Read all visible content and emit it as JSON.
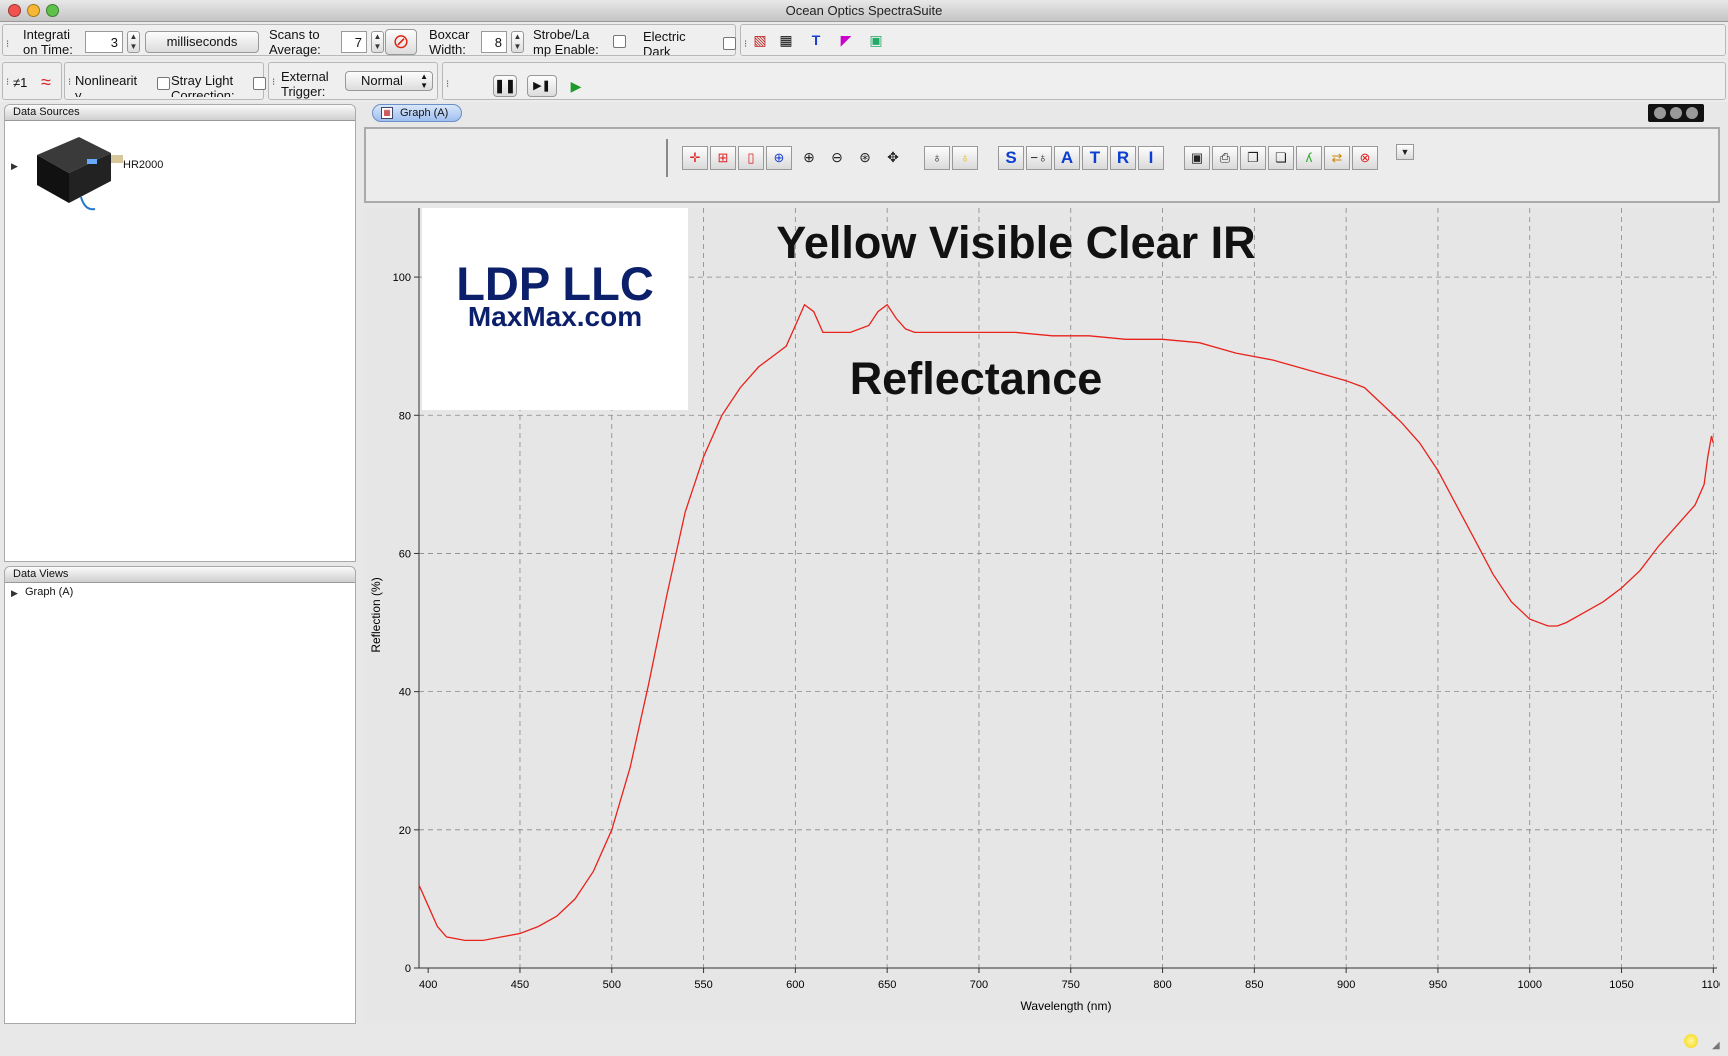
{
  "window": {
    "title": "Ocean Optics SpectraSuite"
  },
  "acquisition": {
    "integration_label": "Integrati\non Time:",
    "integration_value": "3",
    "units": "milliseconds",
    "scans_label": "Scans to\nAverage:",
    "scans_value": "7",
    "boxcar_label": "Boxcar\nWidth:",
    "boxcar_value": "8",
    "strobe_label": "Strobe/La\nmp Enable:",
    "dark_label": "Electric\nDark"
  },
  "corrections": {
    "channel": "≠1",
    "nonlinearity_label": "Nonlinearit\ny",
    "stray_label": "Stray Light\nCorrection:",
    "trigger_label": "External\nTrigger:",
    "trigger_value": "Normal"
  },
  "data_sources": {
    "header": "Data Sources",
    "device": "HR2000"
  },
  "data_views": {
    "header": "Data Views",
    "items": [
      "Graph (A)"
    ]
  },
  "graph": {
    "tab_label": "Graph (A)"
  },
  "chart_toolbar": {
    "letters": [
      "S",
      "A",
      "T",
      "R",
      "I"
    ]
  },
  "overlay": {
    "logo_line1": "LDP LLC",
    "logo_line2": "MaxMax.com",
    "heading": "Yellow Visible Clear IR",
    "subheading": "Reflectance"
  },
  "colors": {
    "curve": "#e8231c",
    "logo_text": "#0b1f6b"
  },
  "chart_data": {
    "type": "line",
    "xlabel": "Wavelength (nm)",
    "ylabel": "Reflection (%)",
    "xlim": [
      395,
      1102
    ],
    "ylim": [
      0,
      110
    ],
    "xticks": [
      400,
      450,
      500,
      550,
      600,
      650,
      700,
      750,
      800,
      850,
      900,
      950,
      1000,
      1050,
      1100
    ],
    "yticks": [
      0,
      20,
      40,
      60,
      80,
      100
    ],
    "grid": true,
    "x": [
      395,
      400,
      405,
      410,
      420,
      430,
      440,
      450,
      460,
      470,
      480,
      490,
      500,
      510,
      520,
      530,
      540,
      550,
      560,
      570,
      580,
      590,
      595,
      600,
      605,
      610,
      615,
      620,
      630,
      640,
      645,
      650,
      655,
      660,
      665,
      670,
      680,
      700,
      720,
      740,
      760,
      780,
      800,
      820,
      840,
      860,
      880,
      900,
      910,
      920,
      930,
      940,
      950,
      960,
      970,
      980,
      990,
      1000,
      1010,
      1015,
      1020,
      1030,
      1040,
      1050,
      1060,
      1070,
      1080,
      1090,
      1095,
      1097,
      1099,
      1100
    ],
    "y": [
      12,
      9,
      6,
      4.5,
      4,
      4,
      4.5,
      5,
      6,
      7.5,
      10,
      14,
      20,
      29,
      41,
      54,
      66,
      74,
      80,
      84,
      87,
      89,
      90,
      93,
      96,
      95,
      92,
      92,
      92,
      93,
      95,
      96,
      94,
      92.5,
      92,
      92,
      92,
      92,
      92,
      91.5,
      91.5,
      91,
      91,
      90.5,
      89,
      88,
      86.5,
      85,
      84,
      81.5,
      79,
      76,
      72,
      67,
      62,
      57,
      53,
      50.5,
      49.5,
      49.5,
      50,
      51.5,
      53,
      55,
      57.5,
      61,
      64,
      67,
      70,
      74,
      77,
      76
    ]
  }
}
